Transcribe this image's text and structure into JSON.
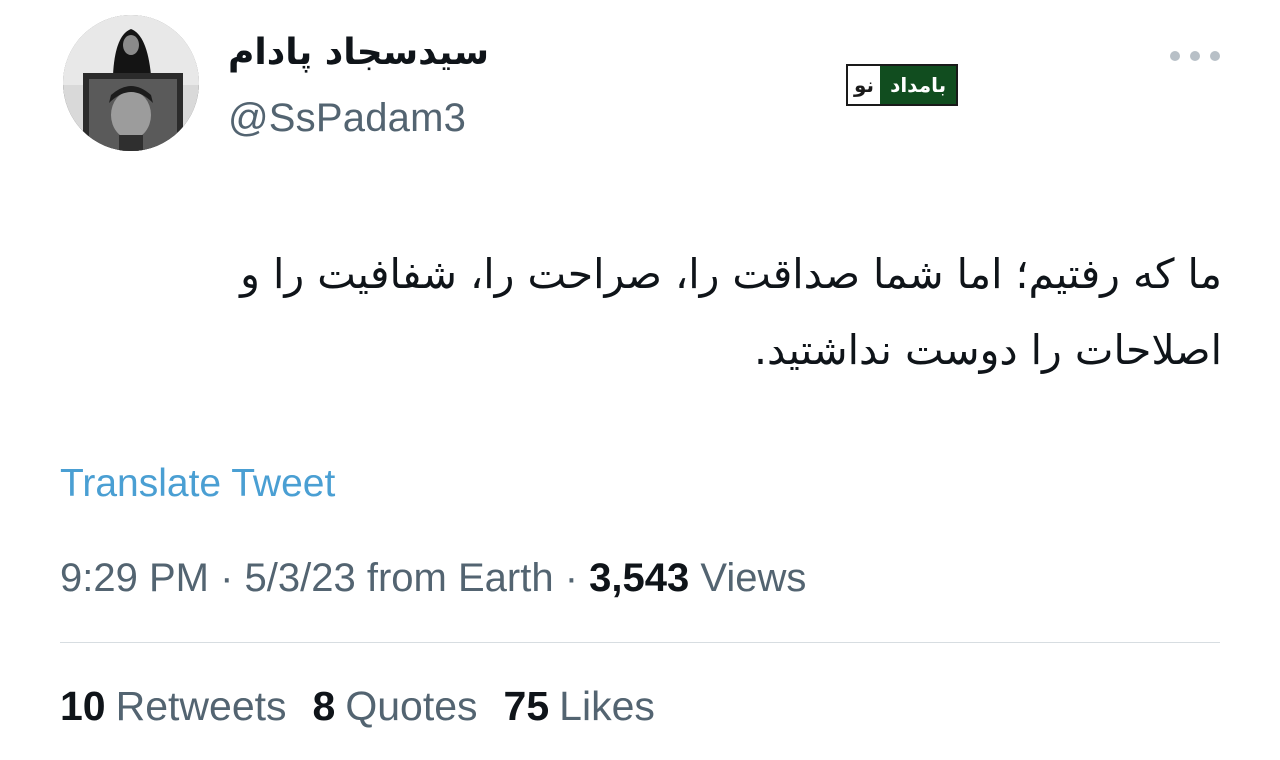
{
  "profile": {
    "display_name": "سیدسجاد پادام",
    "handle": "@SsPadam3"
  },
  "watermark": {
    "dark_text": "بامداد",
    "light_text": "نو",
    "accent_color": "#114d1f"
  },
  "tweet": {
    "text_line_1": "ما که رفتیم؛ اما شما صداقت را، صراحت را، شفافیت را و",
    "text_line_2": "اصلاحات را دوست نداشتید.",
    "translate_label": "Translate Tweet",
    "translate_color": "#4a9fd3"
  },
  "meta": {
    "time": "9:29 PM",
    "date": "5/3/23",
    "source": "from Earth",
    "views_count": "3,543",
    "views_label": "Views"
  },
  "stats": {
    "retweets_count": "10",
    "retweets_label": "Retweets",
    "quotes_count": "8",
    "quotes_label": "Quotes",
    "likes_count": "75",
    "likes_label": "Likes"
  },
  "icons": {
    "more": "more-horizontal-icon"
  }
}
